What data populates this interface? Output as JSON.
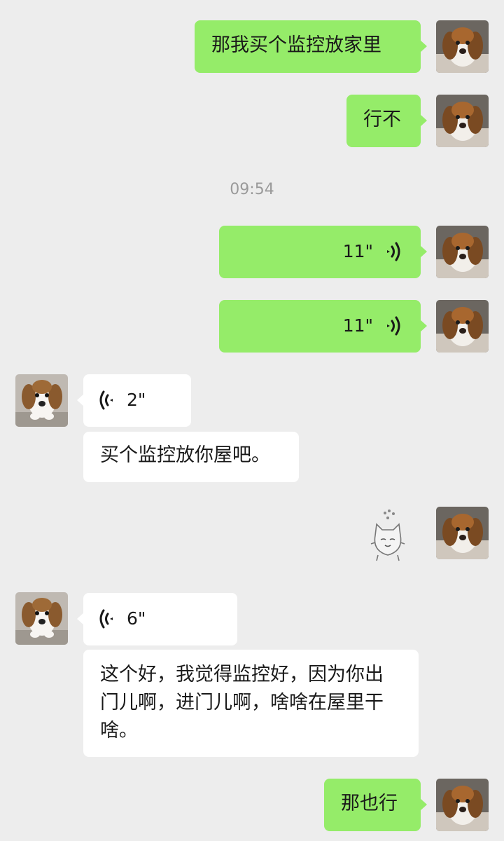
{
  "timestamp": "09:54",
  "messages": [
    {
      "text": "那我买个监控放家里"
    },
    {
      "text": "行不"
    },
    {
      "voice_duration": "11\""
    },
    {
      "voice_duration": "11\""
    },
    {
      "voice_duration": "2\""
    },
    {
      "text": "买个监控放你屋吧。"
    },
    {
      "sticker": "cat-sticker"
    },
    {
      "voice_duration": "6\""
    },
    {
      "text": "这个好，我觉得监控好，因为你出门儿啊，进门儿啊，啥啥在屋里干啥。"
    },
    {
      "text": "那也行"
    }
  ],
  "colors": {
    "background": "#ededed",
    "self_bubble": "#95ec69",
    "other_bubble": "#ffffff",
    "timestamp": "#9a9a9a"
  },
  "icons": {
    "self_avatar": "beagle-puppy-avatar-icon",
    "other_avatar": "beagle-puppy-avatar-icon",
    "voice": "voice-wave-icon"
  }
}
